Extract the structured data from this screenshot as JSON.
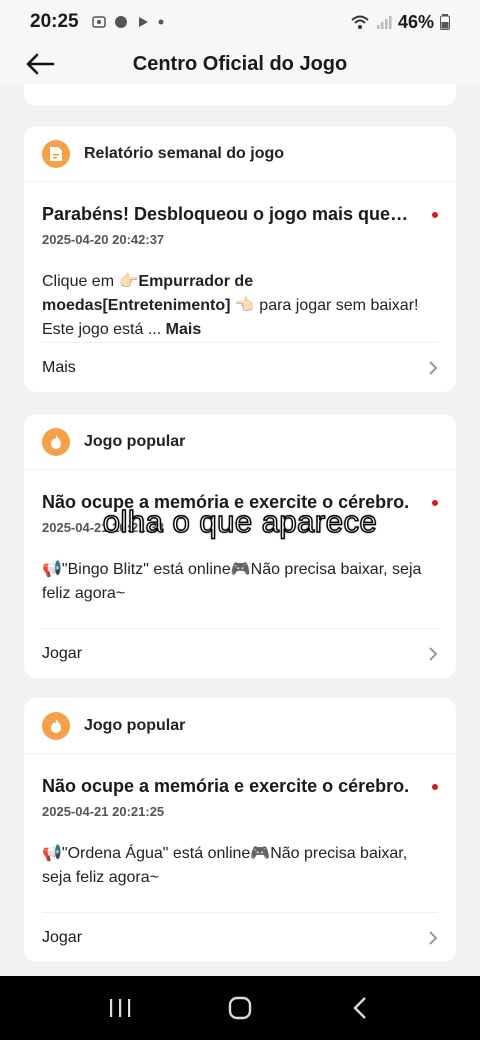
{
  "status_bar": {
    "time": "20:25",
    "battery": "46%"
  },
  "header": {
    "title": "Centro Oficial do Jogo"
  },
  "cards": [
    {
      "category": "Relatório semanal do jogo",
      "title": "Parabéns! Desbloqueou o jogo mais quent…",
      "date": "2025-04-20 20:42:37",
      "body_pre": "Clique em 👉🏻",
      "body_bold": "Empurrador de moedas[Entretenimento]",
      "body_post": "👈🏻 para jogar sem baixar! Este jogo está ...",
      "more_inline": "Mais",
      "footer": "Mais"
    },
    {
      "category": "Jogo popular",
      "title": "Não ocupe a memória e exercite o cérebro.",
      "date": "2025-04-21 20:21:38",
      "body": "📢\"Bingo Blitz\" está online🎮Não precisa baixar, seja feliz agora~",
      "footer": "Jogar"
    },
    {
      "category": "Jogo popular",
      "title": "Não ocupe a memória e exercite o cérebro.",
      "date": "2025-04-21 20:21:25",
      "body": "📢\"Ordena Água\" está online🎮Não precisa baixar, seja feliz agora~",
      "footer": "Jogar"
    }
  ],
  "overlay": {
    "caption": "olha o que aparece"
  },
  "colors": {
    "accent": "#f5a04a",
    "unread_dot": "#e01818"
  },
  "icons": {
    "back": "arrow-left-icon",
    "report": "document-icon",
    "popular": "flame-icon"
  }
}
